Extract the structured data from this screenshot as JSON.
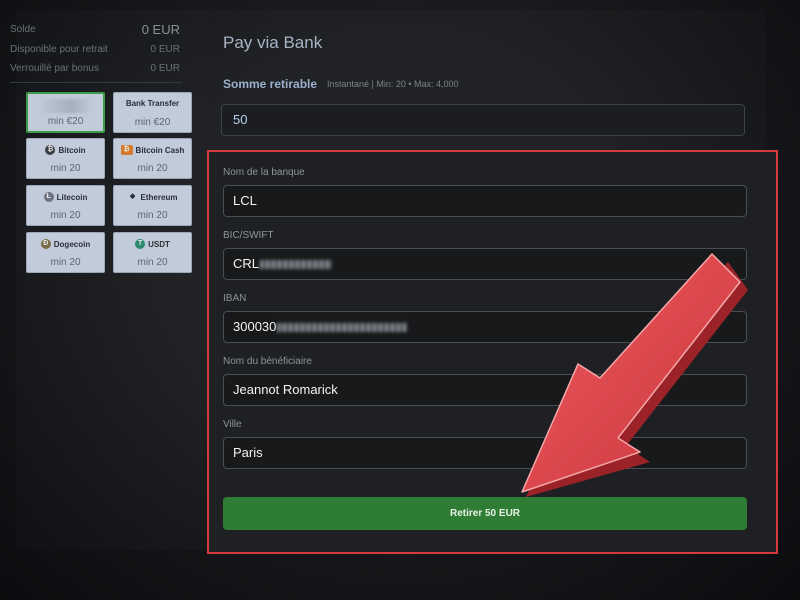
{
  "balance": {
    "solde_label": "Solde",
    "solde_value": "0 EUR",
    "retrait_label": "Disponible pour retrait",
    "retrait_value": "0 EUR",
    "bonus_label": "Verrouillé par bonus",
    "bonus_value": "0 EUR"
  },
  "methods": [
    {
      "name": "",
      "min": "min €20",
      "icon": "payment-logo-icon"
    },
    {
      "name": "Bank Transfer",
      "min": "min €20",
      "icon": ""
    },
    {
      "name": "Bitcoin",
      "min": "min 20",
      "icon": "bitcoin-icon"
    },
    {
      "name": "Bitcoin Cash",
      "min": "min 20",
      "icon": "bitcoin-cash-icon"
    },
    {
      "name": "Litecoin",
      "min": "min 20",
      "icon": "litecoin-icon"
    },
    {
      "name": "Ethereum",
      "min": "min 20",
      "icon": "ethereum-icon"
    },
    {
      "name": "Dogecoin",
      "min": "min 20",
      "icon": "dogecoin-icon"
    },
    {
      "name": "USDT",
      "min": "min 20",
      "icon": "usdt-icon"
    }
  ],
  "form": {
    "title": "Pay via Bank",
    "amount_label": "Somme retirable",
    "amount_limits": "Instantané | Min: 20 • Max: 4,000",
    "amount_value": "50",
    "bank_label": "Nom de la banque",
    "bank_value": "LCL",
    "bic_label": "BIC/SWIFT",
    "bic_value": "CRL",
    "iban_label": "IBAN",
    "iban_value": "300030",
    "beneficiary_label": "Nom du bénéficiaire",
    "beneficiary_value": "Jeannot Romarick",
    "city_label": "Ville",
    "city_value": "Paris",
    "submit_label": "Retirer 50 EUR"
  },
  "colors": {
    "highlight": "#d63a3f",
    "submit": "#2f7d34",
    "arrow": "#e0474c"
  }
}
